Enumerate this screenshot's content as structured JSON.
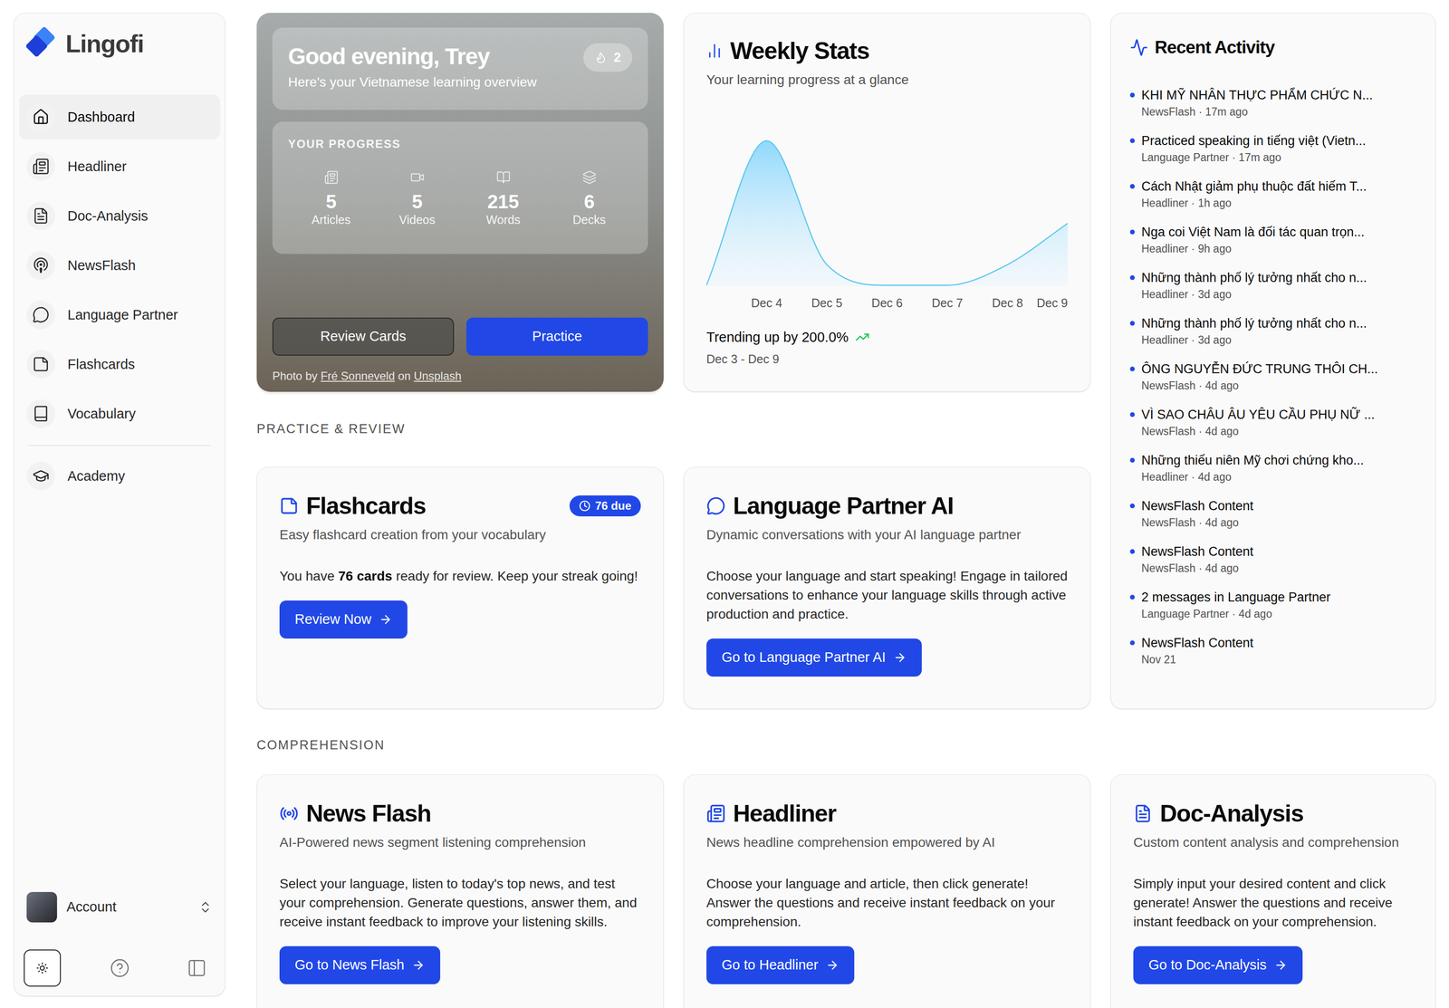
{
  "app": {
    "name": "Lingofi"
  },
  "sidebar": {
    "items": [
      {
        "label": "Dashboard",
        "selected": true
      },
      {
        "label": "Headliner",
        "selected": false
      },
      {
        "label": "Doc-Analysis",
        "selected": false
      },
      {
        "label": "NewsFlash",
        "selected": false
      },
      {
        "label": "Language Partner",
        "selected": false
      },
      {
        "label": "Flashcards",
        "selected": false
      },
      {
        "label": "Vocabulary",
        "selected": false
      }
    ],
    "footer_items": [
      {
        "label": "Academy",
        "selected": false
      }
    ],
    "account": {
      "label": "Account"
    }
  },
  "hero": {
    "greeting": "Good evening, Trey",
    "subtitle": "Here's your Vietnamese learning overview",
    "streak": "2",
    "progress_title": "YOUR PROGRESS",
    "stats": [
      {
        "value": "5",
        "label": "Articles"
      },
      {
        "value": "5",
        "label": "Videos"
      },
      {
        "value": "215",
        "label": "Words"
      },
      {
        "value": "6",
        "label": "Decks"
      }
    ],
    "buttons": [
      {
        "label": "Review Cards",
        "kind": "secondary"
      },
      {
        "label": "Practice",
        "kind": "primary"
      }
    ],
    "credit": {
      "prefix": "Photo by ",
      "author": "Fré Sonneveld",
      "middle": " on ",
      "site": "Unsplash"
    }
  },
  "weekly_stats": {
    "title": "Weekly Stats",
    "subtitle": "Your learning progress at a glance",
    "values": [
      0,
      7,
      1,
      0,
      0,
      1,
      3
    ],
    "ticks": [
      "Dec 4",
      "Dec 5",
      "Dec 6",
      "Dec 7",
      "Dec 8",
      "Dec 9"
    ],
    "trend": "Trending up by 200.0%",
    "range": "Dec 3 - Dec 9"
  },
  "sections": [
    "PRACTICE & REVIEW",
    "COMPREHENSION"
  ],
  "practice_cards": [
    {
      "title": "Flashcards",
      "badge": "76 due",
      "subtitle": "Easy flashcard creation from your vocabulary",
      "body": [
        {
          "text": "You have ",
          "bold": false
        },
        {
          "text": "76 cards",
          "bold": true
        },
        {
          "text": " ready for review. Keep your streak going!",
          "bold": false
        }
      ],
      "button": "Review Now"
    },
    {
      "title": "Language Partner AI",
      "badge": "",
      "subtitle": "Dynamic conversations with your AI language partner",
      "body": [
        {
          "text": "Choose your language and start speaking! Engage in tailored conversations to enhance your language skills through active production and practice.",
          "bold": false
        }
      ],
      "button": "Go to Language Partner AI"
    }
  ],
  "comprehension_cards": [
    {
      "title": "News Flash",
      "subtitle": "AI-Powered news segment listening comprehension",
      "body": "Select your language, listen to today's top news, and test your comprehension. Generate questions, answer them, and receive instant feedback to improve your listening skills.",
      "button": "Go to News Flash"
    },
    {
      "title": "Headliner",
      "subtitle": "News headline comprehension empowered by AI",
      "body": "Choose your language and article, then click generate! Answer the questions and receive instant feedback on your comprehension.",
      "button": "Go to Headliner"
    },
    {
      "title": "Doc-Analysis",
      "subtitle": "Custom content analysis and comprehension",
      "body": "Simply input your desired content and click generate! Answer the questions and receive instant feedback on your comprehension.",
      "button": "Go to Doc-Analysis"
    }
  ],
  "recent_activity": {
    "title": "Recent Activity",
    "items": [
      {
        "title": "KHI MỸ NHÂN THỰC PHẨM CHỨC N...",
        "meta": "NewsFlash · 17m ago"
      },
      {
        "title": "Practiced speaking in tiếng việt (Vietn...",
        "meta": "Language Partner · 17m ago"
      },
      {
        "title": "Cách Nhật giảm phụ thuộc đất hiếm T...",
        "meta": "Headliner · 1h ago"
      },
      {
        "title": "Nga coi Việt Nam là đối tác quan trọn...",
        "meta": "Headliner · 9h ago"
      },
      {
        "title": "Những thành phố lý tưởng nhất cho n...",
        "meta": "Headliner · 3d ago"
      },
      {
        "title": "Những thành phố lý tưởng nhất cho n...",
        "meta": "Headliner · 3d ago"
      },
      {
        "title": "ÔNG NGUYỄN ĐỨC TRUNG THÔI CH...",
        "meta": "NewsFlash · 4d ago"
      },
      {
        "title": "VÌ SAO CHÂU ÂU YÊU CẦU PHỤ NỮ ...",
        "meta": "NewsFlash · 4d ago"
      },
      {
        "title": "Những thiếu niên Mỹ chơi chứng kho...",
        "meta": "Headliner · 4d ago"
      },
      {
        "title": "NewsFlash Content",
        "meta": "NewsFlash · 4d ago"
      },
      {
        "title": "NewsFlash Content",
        "meta": "NewsFlash · 4d ago"
      },
      {
        "title": "2 messages in Language Partner",
        "meta": "Language Partner · 4d ago"
      },
      {
        "title": "NewsFlash Content",
        "meta": "Nov 21"
      }
    ]
  }
}
